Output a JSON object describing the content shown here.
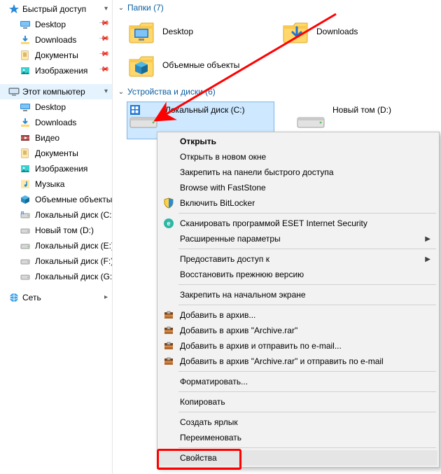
{
  "nav": {
    "quick_access": {
      "label": "Быстрый доступ"
    },
    "items_qa": [
      {
        "label": "Desktop",
        "icon": "desktop",
        "pin": true
      },
      {
        "label": "Downloads",
        "icon": "download",
        "pin": true
      },
      {
        "label": "Документы",
        "icon": "document",
        "pin": true
      },
      {
        "label": "Изображения",
        "icon": "pictures",
        "pin": true
      }
    ],
    "this_pc": {
      "label": "Этот компьютер"
    },
    "items_pc": [
      {
        "label": "Desktop",
        "icon": "desktop"
      },
      {
        "label": "Downloads",
        "icon": "download"
      },
      {
        "label": "Видео",
        "icon": "video"
      },
      {
        "label": "Документы",
        "icon": "document"
      },
      {
        "label": "Изображения",
        "icon": "pictures"
      },
      {
        "label": "Музыка",
        "icon": "music"
      },
      {
        "label": "Объемные объекты",
        "icon": "objects3d"
      },
      {
        "label": "Локальный диск (C:)",
        "icon": "drive-c"
      },
      {
        "label": "Новый том (D:)",
        "icon": "drive"
      },
      {
        "label": "Локальный диск (E:)",
        "icon": "drive"
      },
      {
        "label": "Локальный диск (F:)",
        "icon": "drive"
      },
      {
        "label": "Локальный диск (G:)",
        "icon": "drive"
      }
    ],
    "network": {
      "label": "Сеть"
    }
  },
  "sections": {
    "folders": {
      "title": "Папки (7)"
    },
    "drives": {
      "title": "Устройства и диски (6)"
    }
  },
  "folders": [
    {
      "label": "Desktop",
      "icon": "desktop-large"
    },
    {
      "label": "Downloads",
      "icon": "download-large"
    },
    {
      "label": "Объемные объекты",
      "icon": "objects3d-large"
    }
  ],
  "drives": [
    {
      "label": "Локальный диск (C:)",
      "icon": "drive-c-large",
      "selected": true
    },
    {
      "label": "Новый том (D:)",
      "icon": "drive-large"
    }
  ],
  "context_menu": [
    {
      "label": "Открыть",
      "bold": true
    },
    {
      "label": "Открыть в новом окне"
    },
    {
      "label": "Закрепить на панели быстрого доступа"
    },
    {
      "label": "Browse with FastStone"
    },
    {
      "label": "Включить BitLocker",
      "icon": "shield"
    },
    {
      "sep": true
    },
    {
      "label": "Сканировать программой ESET Internet Security",
      "icon": "eset"
    },
    {
      "label": "Расширенные параметры",
      "icon": "",
      "submenu": true
    },
    {
      "sep": true
    },
    {
      "label": "Предоставить доступ к",
      "submenu": true
    },
    {
      "label": "Восстановить прежнюю версию"
    },
    {
      "sep": true
    },
    {
      "label": "Закрепить на начальном экране"
    },
    {
      "sep": true
    },
    {
      "label": "Добавить в архив...",
      "icon": "rar"
    },
    {
      "label": "Добавить в архив \"Archive.rar\"",
      "icon": "rar"
    },
    {
      "label": "Добавить в архив и отправить по e-mail...",
      "icon": "rar"
    },
    {
      "label": "Добавить в архив \"Archive.rar\" и отправить по e-mail",
      "icon": "rar"
    },
    {
      "sep": true
    },
    {
      "label": "Форматировать..."
    },
    {
      "sep": true
    },
    {
      "label": "Копировать"
    },
    {
      "sep": true
    },
    {
      "label": "Создать ярлык"
    },
    {
      "label": "Переименовать"
    },
    {
      "sep": true
    },
    {
      "label": "Свойства",
      "highlight": true
    }
  ]
}
